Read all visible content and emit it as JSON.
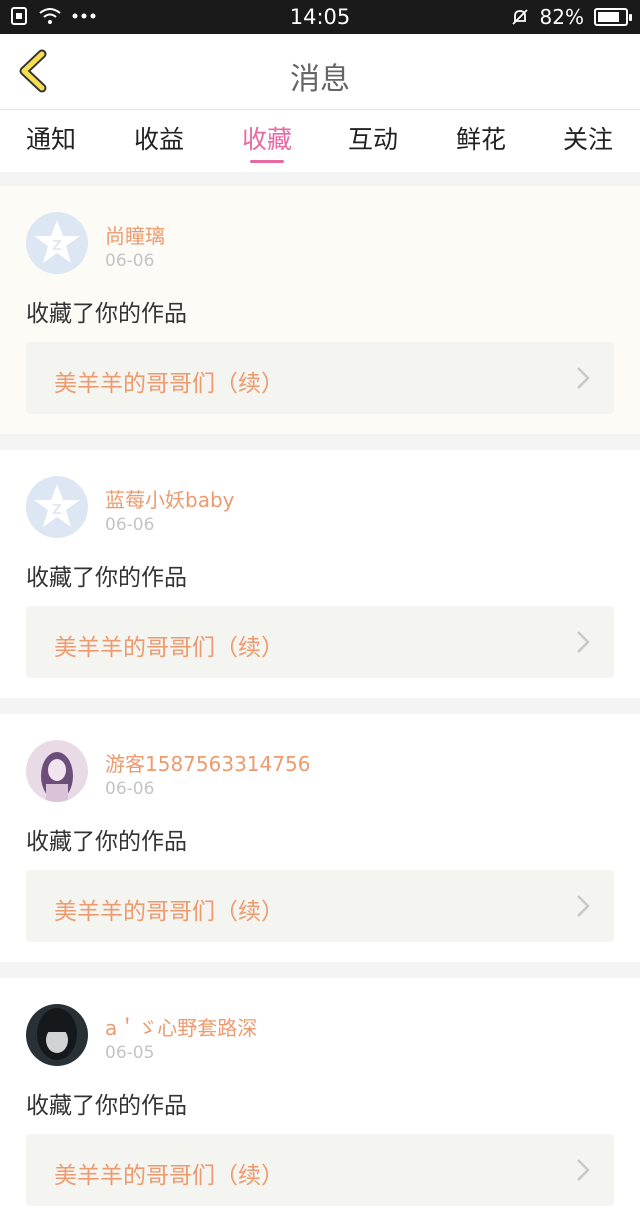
{
  "status": {
    "time": "14:05",
    "battery": "82%",
    "battery_level": 0.82
  },
  "header": {
    "title": "消息",
    "back_icon": "chevron-left-icon"
  },
  "tabs": [
    {
      "label": "通知",
      "active": false
    },
    {
      "label": "收益",
      "active": false
    },
    {
      "label": "收藏",
      "active": true
    },
    {
      "label": "互动",
      "active": false
    },
    {
      "label": "鲜花",
      "active": false
    },
    {
      "label": "关注",
      "active": false
    }
  ],
  "colors": {
    "accent": "#e86aa3",
    "name": "#ee9a6f",
    "work_bg": "#f4f4f0"
  },
  "messages": [
    {
      "name": "尚瞳璃",
      "date": "06-06",
      "action": "收藏了你的作品",
      "work": "美羊羊的哥哥们（续）",
      "avatar": "default-qq-avatar"
    },
    {
      "name": "蓝莓小妖baby",
      "date": "06-06",
      "action": "收藏了你的作品",
      "work": "美羊羊的哥哥们（续）",
      "avatar": "default-qq-avatar"
    },
    {
      "name": "游客1587563314756",
      "date": "06-06",
      "action": "收藏了你的作品",
      "work": "美羊羊的哥哥们（续）",
      "avatar": "girl-purple-avatar"
    },
    {
      "name": "a＇ゞ心野套路深",
      "date": "06-05",
      "action": "收藏了你的作品",
      "work": "美羊羊的哥哥们（续）",
      "avatar": "girl-dark-avatar"
    }
  ]
}
